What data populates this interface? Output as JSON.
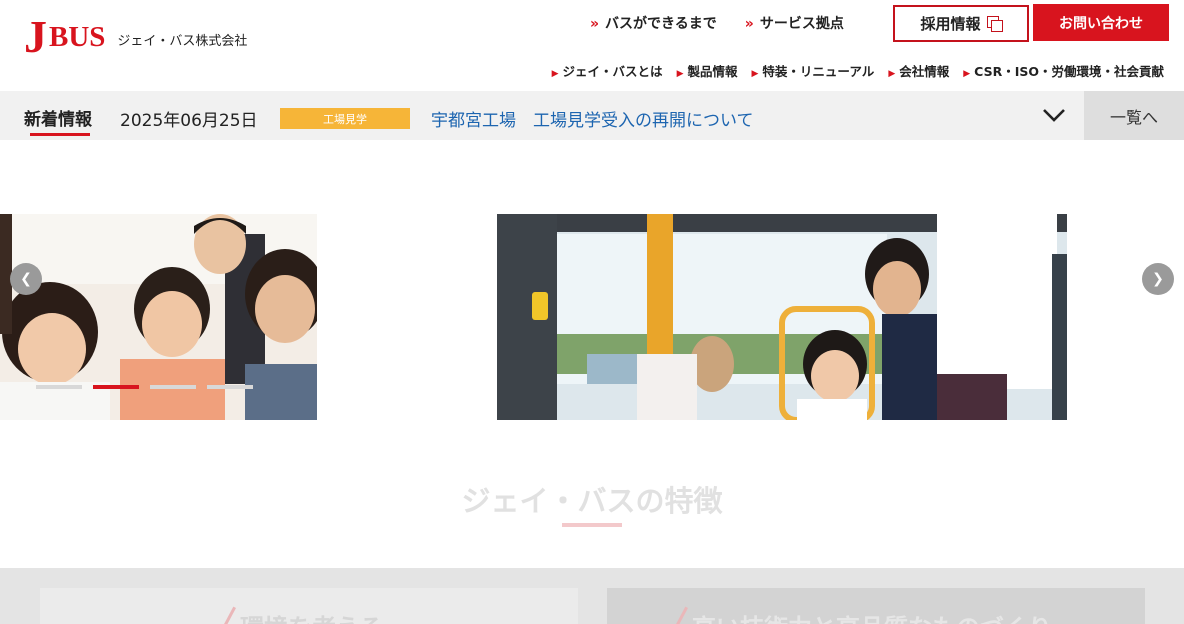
{
  "header": {
    "logo_j": "J",
    "logo_bus": "BUS",
    "company": "ジェイ・バス株式会社",
    "top_nav": [
      {
        "label": "バスができるまで"
      },
      {
        "label": "サービス拠点"
      }
    ],
    "recruit_label": "採用情報",
    "contact_label": "お問い合わせ",
    "sub_nav": [
      {
        "label": "ジェイ・バスとは"
      },
      {
        "label": "製品情報"
      },
      {
        "label": "特装・リニューアル"
      },
      {
        "label": "会社情報"
      },
      {
        "label": "CSR・ISO・労働環境・社会貢献"
      }
    ]
  },
  "news": {
    "label": "新着情報",
    "date": "2025年06月25日",
    "tag": "工場見学",
    "title": "宇都宮工場　工場見学受入の再開について",
    "all_label": "一覧へ"
  },
  "slider": {
    "dot_count": 4,
    "active_dot": 1
  },
  "features": {
    "title": "ジェイ・バスの特徴",
    "cards": [
      {
        "label": "環境を考える"
      },
      {
        "label": "高い技術力と高品質なものづくり"
      }
    ]
  },
  "colors": {
    "brand_red": "#d8141e",
    "tag_yellow": "#f6b538",
    "link_blue": "#1d65b0"
  }
}
